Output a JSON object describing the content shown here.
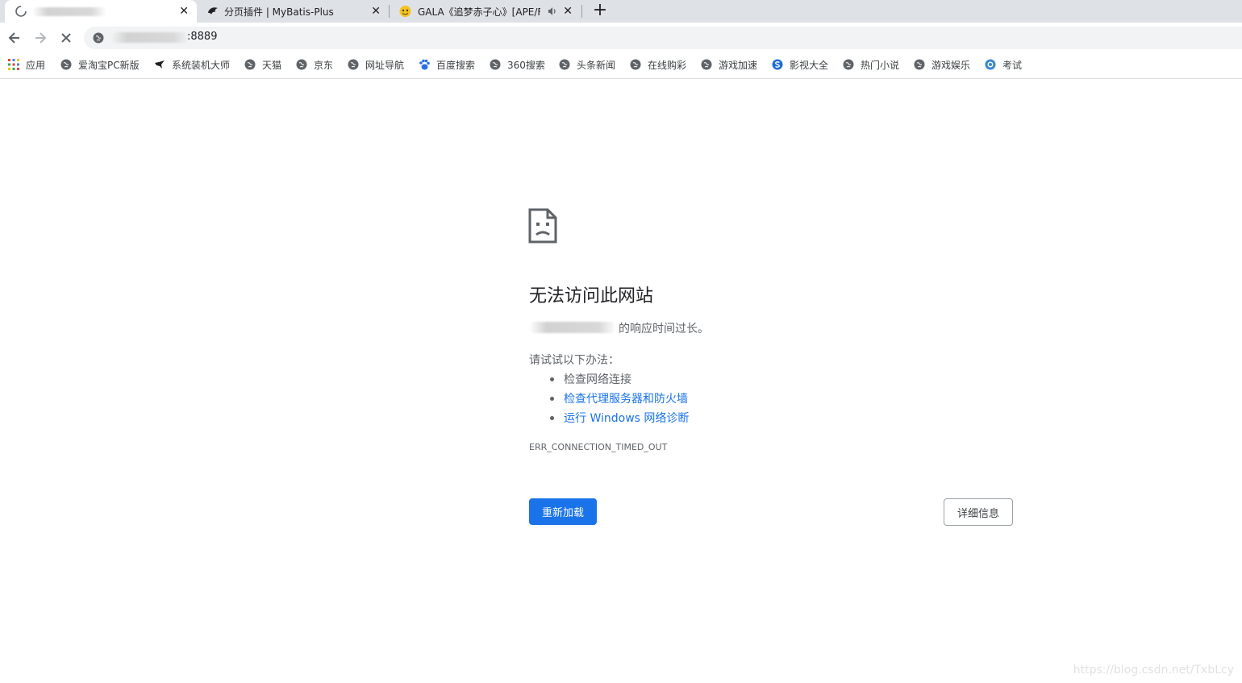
{
  "tabs": [
    {
      "title": "",
      "loading": true,
      "active": true
    },
    {
      "title": "分页插件 | MyBatis-Plus",
      "active": false
    },
    {
      "title": "GALA《追梦赤子心》[APE/F",
      "audio": true,
      "active": false
    }
  ],
  "tab_close_glyph": "✕",
  "new_tab_glyph": "+",
  "toolbar": {
    "url_suffix": ":8889"
  },
  "bookmarks": [
    {
      "label": "应用",
      "icon": "apps-grid-icon"
    },
    {
      "label": "爱淘宝PC新版",
      "icon": "globe-icon"
    },
    {
      "label": "系统装机大师",
      "icon": "bird-icon"
    },
    {
      "label": "天猫",
      "icon": "globe-icon"
    },
    {
      "label": "京东",
      "icon": "globe-icon"
    },
    {
      "label": "网址导航",
      "icon": "globe-icon"
    },
    {
      "label": "百度搜索",
      "icon": "baidu-paw-icon"
    },
    {
      "label": "360搜索",
      "icon": "globe-icon"
    },
    {
      "label": "头条新闻",
      "icon": "globe-icon"
    },
    {
      "label": "在线购彩",
      "icon": "globe-icon"
    },
    {
      "label": "游戏加速",
      "icon": "globe-icon"
    },
    {
      "label": "影视大全",
      "icon": "sogou-icon"
    },
    {
      "label": "热门小说",
      "icon": "globe-icon"
    },
    {
      "label": "游戏娱乐",
      "icon": "globe-icon"
    },
    {
      "label": "考试",
      "icon": "exam-icon"
    }
  ],
  "error": {
    "heading": "无法访问此网站",
    "response_suffix": "的响应时间过长。",
    "try_label": "请试试以下办法：",
    "suggestions": [
      {
        "text": "检查网络连接",
        "link": false
      },
      {
        "text": "检查代理服务器和防火墙",
        "link": true
      },
      {
        "text": "运行 Windows 网络诊断",
        "link": true
      }
    ],
    "code": "ERR_CONNECTION_TIMED_OUT",
    "reload_label": "重新加载",
    "details_label": "详细信息"
  },
  "watermark": "https://blog.csdn.net/TxbLcy",
  "colors": {
    "accent": "#1a73e8",
    "tabstrip": "#dee1e6",
    "omnibox": "#f1f3f4"
  }
}
